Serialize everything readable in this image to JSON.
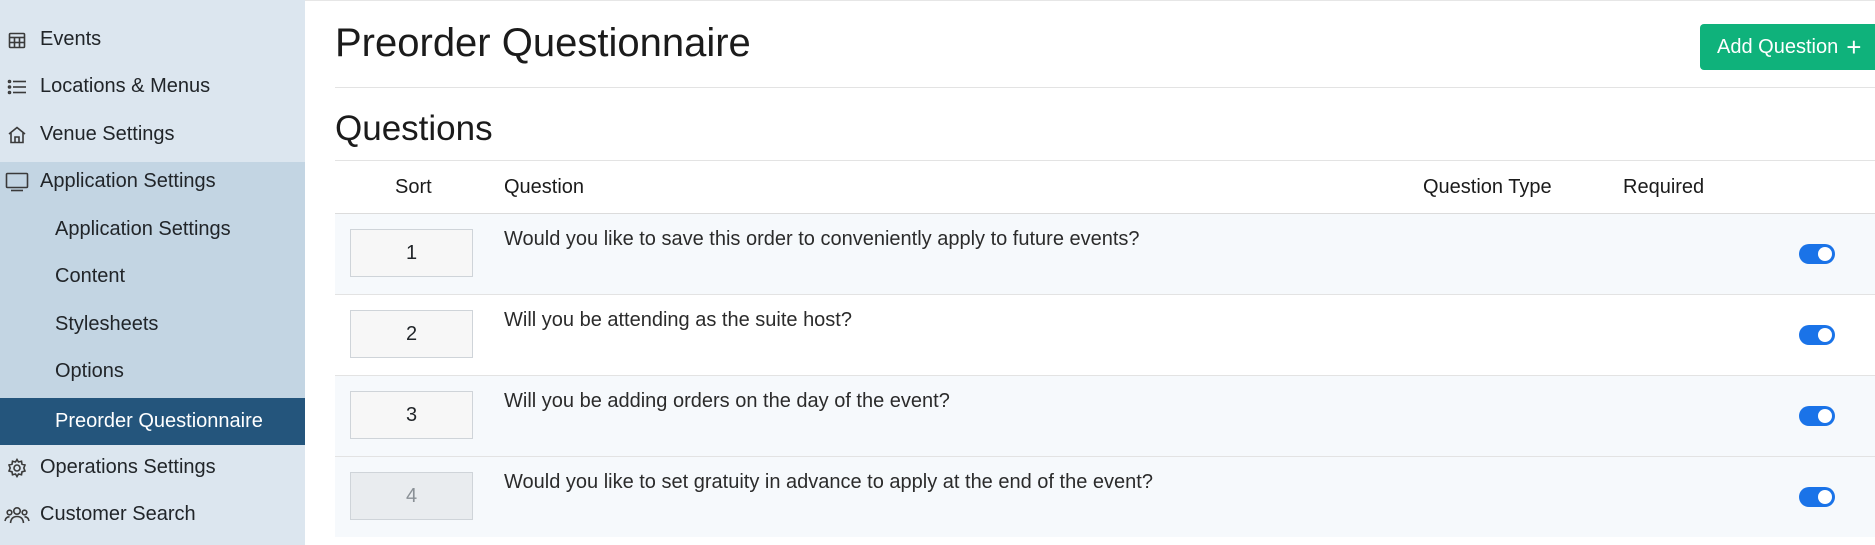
{
  "sidebar": {
    "items": [
      {
        "label": "Events",
        "icon": "calendar-icon"
      },
      {
        "label": "Locations & Menus",
        "icon": "list-icon"
      },
      {
        "label": "Venue Settings",
        "icon": "home-icon"
      },
      {
        "label": "Application Settings",
        "icon": "monitor-icon"
      },
      {
        "label": "Operations Settings",
        "icon": "gear-icon"
      },
      {
        "label": "Customer Search",
        "icon": "users-icon"
      }
    ],
    "subitems": [
      {
        "label": "Application Settings"
      },
      {
        "label": "Content"
      },
      {
        "label": "Stylesheets"
      },
      {
        "label": "Options"
      },
      {
        "label": "Preorder Questionnaire",
        "active": true
      }
    ]
  },
  "header": {
    "title": "Preorder Questionnaire",
    "add_button_label": "Add Question",
    "add_button_color": "#0fb27b"
  },
  "section": {
    "title": "Questions"
  },
  "table": {
    "columns": [
      "Sort",
      "Question",
      "Question Type",
      "Required"
    ],
    "rows": [
      {
        "sort": "1",
        "question": "Would you like to save this order to conveniently apply to future events?",
        "question_type": "",
        "required": true
      },
      {
        "sort": "2",
        "question": "Will you be attending as the suite host?",
        "question_type": "",
        "required": true
      },
      {
        "sort": "3",
        "question": "Will you be adding orders on the day of the event?",
        "question_type": "",
        "required": true
      },
      {
        "sort": "4",
        "question": "Would you like to set gratuity in advance to apply at the end of the event?",
        "question_type": "",
        "required": true
      }
    ]
  },
  "colors": {
    "sidebar_bg": "#dce6ef",
    "submenu_bg": "#c3d5e3",
    "active_bg": "#24557c",
    "toggle_on": "#1a73e8"
  }
}
